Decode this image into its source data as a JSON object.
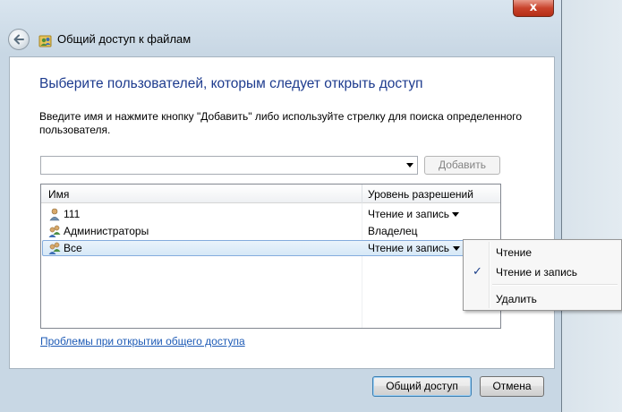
{
  "window": {
    "title": "Общий доступ к файлам",
    "close_glyph": "x",
    "back_icon": "back-arrow-icon"
  },
  "main": {
    "heading": "Выберите пользователей, которым следует открыть доступ",
    "instructions": "Введите имя и нажмите кнопку \"Добавить\" либо используйте стрелку для поиска определенного пользователя.",
    "user_input": {
      "value": "",
      "placeholder": ""
    },
    "add_button": "Добавить",
    "columns": {
      "name": "Имя",
      "permission": "Уровень разрешений"
    },
    "rows": [
      {
        "name": "111",
        "permission": "Чтение и запись",
        "icon": "user-icon",
        "has_dropdown": true
      },
      {
        "name": "Администраторы",
        "permission": "Владелец",
        "icon": "group-icon",
        "has_dropdown": false
      },
      {
        "name": "Все",
        "permission": "Чтение и запись",
        "icon": "group-icon",
        "has_dropdown": true,
        "selected": true
      }
    ],
    "help_link": "Проблемы при открытии общего доступа"
  },
  "context_menu": {
    "items": [
      {
        "label": "Чтение",
        "checked": false
      },
      {
        "label": "Чтение и запись",
        "checked": true
      },
      {
        "label": "Удалить",
        "checked": false
      }
    ],
    "check_glyph": "✓"
  },
  "footer": {
    "share_button": "Общий доступ",
    "cancel_button": "Отмена"
  },
  "colors": {
    "heading": "#1d3b8e",
    "link": "#1e5bb6",
    "selection_border": "#84acdd",
    "close_button": "#c9432c"
  }
}
